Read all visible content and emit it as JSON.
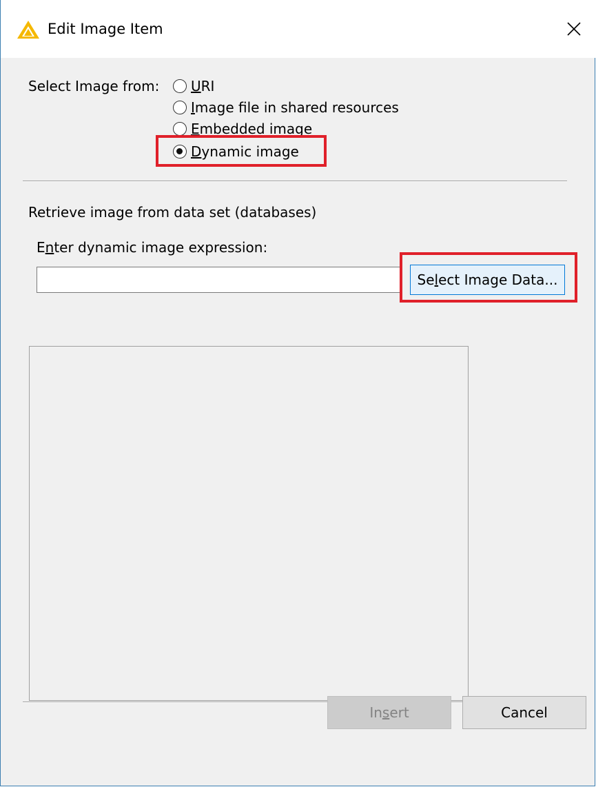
{
  "dialog": {
    "title": "Edit Image Item",
    "icon": "warning-triangle-icon",
    "close_icon": "close-icon"
  },
  "source": {
    "label": "Select Image from:",
    "options": [
      {
        "pre": "",
        "mn": "U",
        "post": "RI",
        "checked": false
      },
      {
        "pre": "",
        "mn": "I",
        "post": "mage file in shared resources",
        "checked": false
      },
      {
        "pre": "",
        "mn": "E",
        "post": "mbedded image",
        "checked": false
      },
      {
        "pre": "",
        "mn": "D",
        "post": "ynamic image",
        "checked": true
      }
    ]
  },
  "dynamic": {
    "description": "Retrieve image from data set (databases)",
    "expression_label_pre": "E",
    "expression_label_mn": "n",
    "expression_label_post": "ter dynamic image expression:",
    "expression_value": "",
    "select_button_pre": "Se",
    "select_button_mn": "l",
    "select_button_post": "ect Image Data..."
  },
  "footer": {
    "insert_pre": "In",
    "insert_mn": "s",
    "insert_post": "ert",
    "insert_enabled": false,
    "cancel_label": "Cancel"
  },
  "colors": {
    "highlight": "#e0202a",
    "accent": "#0078d7",
    "icon_yellow": "#f5b800"
  }
}
